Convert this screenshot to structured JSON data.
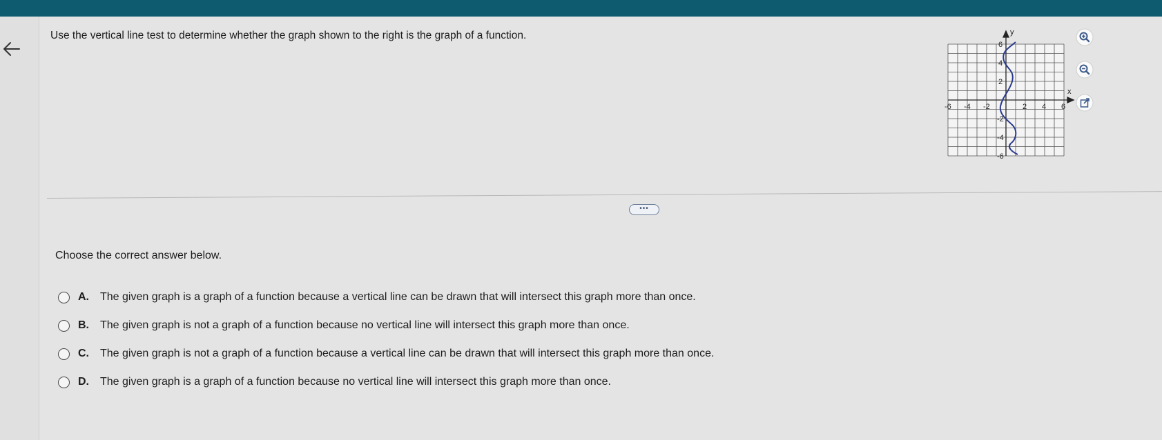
{
  "question": {
    "text": "Use the vertical line test to determine whether the graph shown to the right is the graph of a function."
  },
  "graph": {
    "x_axis_label": "x",
    "y_axis_label": "y",
    "x_ticks": [
      "-6",
      "-4",
      "-2",
      "2",
      "4",
      "6"
    ],
    "y_ticks": [
      "6",
      "4",
      "2",
      "-2",
      "-4",
      "-6"
    ],
    "curve_color": "#2a3a8c"
  },
  "tools": {
    "zoom_in": "zoom-in-icon",
    "zoom_out": "zoom-out-icon",
    "open_external": "external-link-icon"
  },
  "more_button": {
    "label": "•••"
  },
  "prompt": {
    "text": "Choose the correct answer below."
  },
  "choices": [
    {
      "letter": "A.",
      "text": "The given graph is a graph of a function because a vertical line can be drawn that will intersect this graph more than once."
    },
    {
      "letter": "B.",
      "text": "The given graph is not a graph of a function because no vertical line will intersect this graph more than once."
    },
    {
      "letter": "C.",
      "text": "The given graph is not a graph of a function because a vertical line can be drawn that will intersect this graph more than once."
    },
    {
      "letter": "D.",
      "text": "The given graph is a graph of a function because no vertical line will intersect this graph more than once."
    }
  ],
  "colors": {
    "top_bar": "#0e5a6e",
    "accent": "#3d5a8a"
  }
}
